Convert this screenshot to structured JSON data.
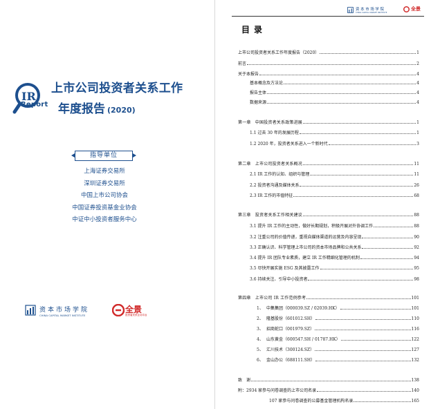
{
  "cover": {
    "logo_letters": "IR",
    "logo_word": "Report",
    "title_line1": "上市公司投资者关系工作",
    "title_line2": "年度报告",
    "year": "(2020)",
    "guide_label": "指导单位",
    "guide_units": [
      "上海证券交易所",
      "深圳证券交易所",
      "中国上市公司协会",
      "中国证券投资基金业协会",
      "中证中小投资者服务中心"
    ],
    "publisher_cn": "资本市场学院",
    "publisher_en": "CHINA CAPITAL MARKET INSTITUTE",
    "partner_name": "全景",
    "partner_sub": "投资者关系互动平台"
  },
  "header": {
    "publisher_cn": "资本市场学院",
    "publisher_en": "CHINA CAPITAL MARKET INSTITUTE",
    "partner_name": "全景"
  },
  "toc": {
    "title": "目录",
    "entries": [
      {
        "label": "上市公司投资者关系工作年度报告（2020）",
        "page": "1",
        "indent": 0,
        "type": "top"
      },
      {
        "label": "前言",
        "page": "2",
        "indent": 0,
        "type": "top"
      },
      {
        "label": "关于本报告",
        "page": "4",
        "indent": 0,
        "type": "top"
      },
      {
        "label": "基本概念及方法论",
        "page": "4",
        "indent": 1,
        "type": "sub"
      },
      {
        "label": "报告主体",
        "page": "4",
        "indent": 1,
        "type": "sub"
      },
      {
        "label": "数据来源",
        "page": "4",
        "indent": 1,
        "type": "sub"
      },
      {
        "label": "第一章　中国投资者关系政策进展",
        "page": "1",
        "indent": 0,
        "type": "chapter"
      },
      {
        "label": "1.1 过去 30 年的发展历程",
        "page": "1",
        "indent": 1,
        "type": "sub"
      },
      {
        "label": "1.2 2020 年，投资者关系进入一个新时代",
        "page": "3",
        "indent": 1,
        "type": "sub"
      },
      {
        "label": "第二章　上市公司投资者关系概况",
        "page": "11",
        "indent": 0,
        "type": "chapter"
      },
      {
        "label": "2.1 IR 工作的认知、组织与管理",
        "page": "11",
        "indent": 1,
        "type": "sub"
      },
      {
        "label": "2.2 投资者沟通及媒体关系",
        "page": "26",
        "indent": 1,
        "type": "sub"
      },
      {
        "label": "2.3 IR 工作的市值特征",
        "page": "68",
        "indent": 1,
        "type": "sub"
      },
      {
        "label": "第三章　投资者关系工作相关建议",
        "page": "88",
        "indent": 0,
        "type": "chapter"
      },
      {
        "label": "3.1 提升 IR 工作的主动性，做好长期规划，积极开展对外协调工作",
        "page": "88",
        "indent": 1,
        "type": "sub"
      },
      {
        "label": "3.2 注重公司的价值传递，重视自媒体渠道的运营及内容呈现",
        "page": "90",
        "indent": 1,
        "type": "sub"
      },
      {
        "label": "3.3 正确认识、科学管理上市公司的资本市场品牌和公共关系",
        "page": "92",
        "indent": 1,
        "type": "sub"
      },
      {
        "label": "3.4 提升 IR 团队专业素质，建立 IR 工作精细化管理的机制",
        "page": "94",
        "indent": 1,
        "type": "sub"
      },
      {
        "label": "3.5 尽快开展实施 ESG 及其披露工作",
        "page": "95",
        "indent": 1,
        "type": "sub"
      },
      {
        "label": "3.6 持续关注、引导中小投资者",
        "page": "98",
        "indent": 1,
        "type": "sub"
      },
      {
        "label": "第四章　上市公司 IR 工作范例参考",
        "page": "101",
        "indent": 0,
        "type": "chapter"
      },
      {
        "label": "中集集团（000039.SZ / 02039.HK）",
        "num": "1、",
        "page": "101",
        "indent": 1,
        "type": "case"
      },
      {
        "label": "隆基股份（601012.SH）",
        "num": "2、",
        "page": "110",
        "indent": 1,
        "type": "case"
      },
      {
        "label": "招商蛇口（001979.SZ）",
        "num": "3、",
        "page": "116",
        "indent": 1,
        "type": "case"
      },
      {
        "label": "山东黄金（600547.SH / 01787.HK）",
        "num": "4、",
        "page": "122",
        "indent": 1,
        "type": "case"
      },
      {
        "label": "汇川技术（300124.SZ）",
        "num": "5、",
        "page": "127",
        "indent": 1,
        "type": "case"
      },
      {
        "label": "金山办公（688111.SH）",
        "num": "6、",
        "page": "132",
        "indent": 1,
        "type": "case"
      },
      {
        "label": "致　谢",
        "page": "138",
        "indent": 0,
        "type": "top"
      },
      {
        "label": "附：2934 家参与问卷调查的上市公司名录",
        "page": "140",
        "indent": 0,
        "type": "top"
      },
      {
        "label": "107 家参与问卷调查的公募基金管理机构名录",
        "page": "165",
        "indent": 2,
        "type": "sub"
      }
    ]
  },
  "colors": {
    "brand_blue": "#1d4f8e",
    "brand_red": "#d12b2b"
  }
}
